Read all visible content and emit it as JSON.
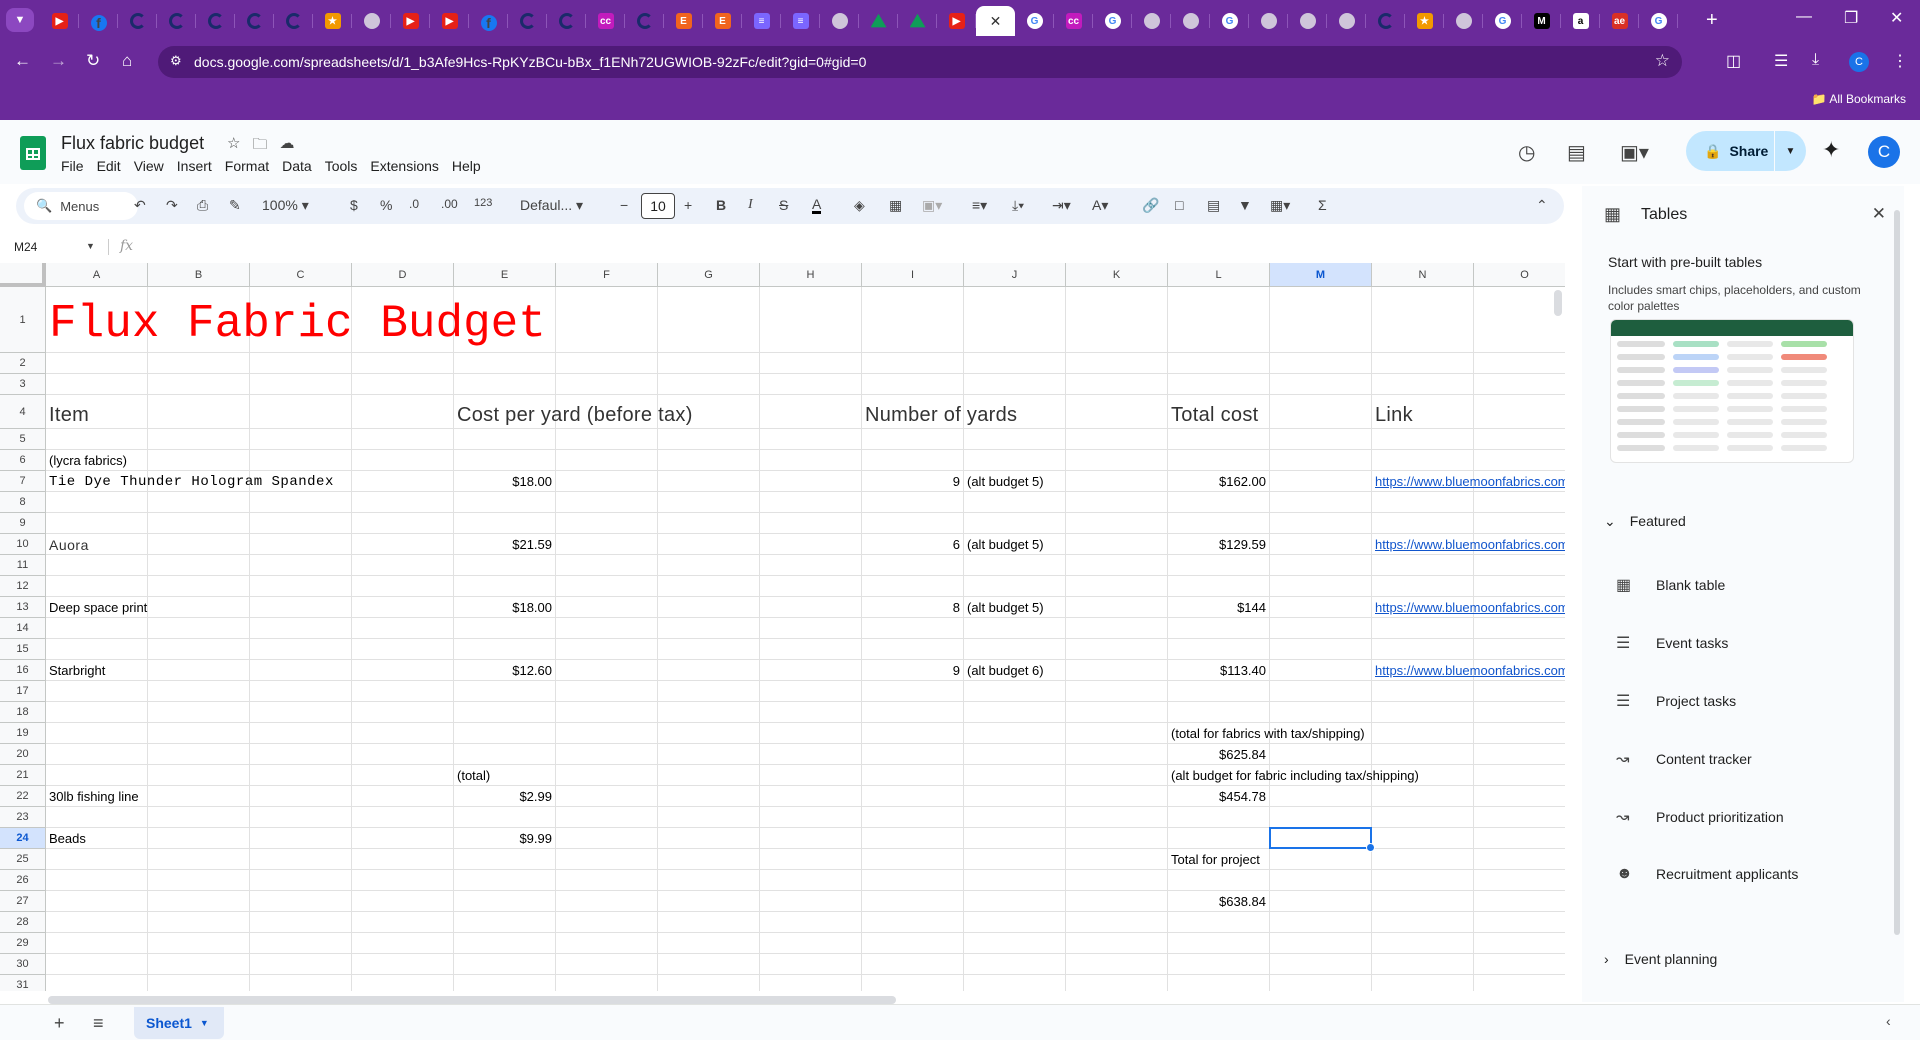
{
  "browser": {
    "url": "docs.google.com/spreadsheets/d/1_b3Afe9Hcs-RpKYzBCu-bBx_f1ENh72UGWIOB-92zFc/edit?gid=0#gid=0",
    "all_bookmarks": "All Bookmarks",
    "tab_favicons": [
      "y",
      "fb",
      "c",
      "c",
      "c",
      "c",
      "c",
      "or",
      "gr",
      "y",
      "y",
      "fb",
      "c",
      "c",
      "cc",
      "c",
      "e",
      "e",
      "gl",
      "gl",
      "gr",
      "dr",
      "dr",
      "y",
      "active",
      "g",
      "cc",
      "g",
      "gr",
      "gr",
      "g",
      "gr",
      "gr",
      "gr",
      "c",
      "or",
      "gr",
      "g",
      "blk",
      "am",
      "red2",
      "g"
    ],
    "profile_initial": "C"
  },
  "doc": {
    "title": "Flux fabric budget",
    "menus": [
      "File",
      "Edit",
      "View",
      "Insert",
      "Format",
      "Data",
      "Tools",
      "Extensions",
      "Help"
    ],
    "share_label": "Share",
    "avatar_initial": "C"
  },
  "toolbar": {
    "menus_label": "Menus",
    "zoom": "100%",
    "currency": "$",
    "percent": "%",
    "dec_decrease": ".0",
    "dec_increase": ".00",
    "number_format": "123",
    "font": "Defaul...",
    "font_size": "10"
  },
  "formula": {
    "name_box": "M24",
    "fx": "fx"
  },
  "grid": {
    "columns": [
      "A",
      "B",
      "C",
      "D",
      "E",
      "F",
      "G",
      "H",
      "I",
      "J",
      "K",
      "L",
      "M",
      "N",
      "O"
    ],
    "rows": [
      "1",
      "2",
      "3",
      "4",
      "5",
      "6",
      "7",
      "8",
      "9",
      "10",
      "11",
      "12",
      "13",
      "14",
      "15",
      "16",
      "17",
      "18",
      "19",
      "20",
      "21",
      "22",
      "23",
      "24",
      "25",
      "26",
      "27",
      "28",
      "29",
      "30",
      "31"
    ],
    "selected_column": "M",
    "selected_row": "24"
  },
  "cells": {
    "A1": "Flux Fabric Budget",
    "A4": "Item",
    "E4": "Cost per yard (before tax)",
    "I4": "Number of yards",
    "L4": "Total cost",
    "N4": "Link",
    "A6": "(lycra fabrics)",
    "A7": "Tie Dye Thunder Hologram Spandex",
    "E7": "$18.00",
    "I7": "9",
    "J7": "(alt budget 5)",
    "L7": "$162.00",
    "N7": "https://www.bluemoonfabrics.com",
    "A10": "Auora",
    "E10": "$21.59",
    "I10": "6",
    "J10": "(alt budget 5)",
    "L10": "$129.59",
    "N10": "https://www.bluemoonfabrics.com",
    "A13": "Deep space print",
    "E13": "$18.00",
    "I13": "8",
    "J13": "(alt budget 5)",
    "L13": "$144",
    "N13": "https://www.bluemoonfabrics.com",
    "A16": "Starbright",
    "E16": "$12.60",
    "I16": "9",
    "J16": "(alt budget 6)",
    "L16": "$113.40",
    "N16": "https://www.bluemoonfabrics.com",
    "L19": "(total for fabrics with tax/shipping)",
    "L20": "$625.84",
    "E21": "(total)",
    "L21": "(alt budget for fabric including tax/shipping)",
    "A22": "30lb fishing line",
    "E22": "$2.99",
    "L22": "$454.78",
    "A24": "Beads",
    "E24": "$9.99",
    "L25": "Total for project",
    "L27": "$638.84"
  },
  "sheet_tabs": [
    "Sheet1"
  ],
  "panel": {
    "title": "Tables",
    "prebuilt_heading": "Start with pre-built tables",
    "prebuilt_sub": "Includes smart chips, placeholders, and custom color palettes",
    "featured_label": "Featured",
    "templates": [
      {
        "label": "Blank table",
        "icon": "table-icon"
      },
      {
        "label": "Event tasks",
        "icon": "checklist-icon"
      },
      {
        "label": "Project tasks",
        "icon": "checklist-icon"
      },
      {
        "label": "Content tracker",
        "icon": "trend-icon"
      },
      {
        "label": "Product prioritization",
        "icon": "trend-icon"
      },
      {
        "label": "Recruitment applicants",
        "icon": "person-icon"
      }
    ],
    "event_planning_label": "Event planning"
  },
  "colors": {
    "chrome": "#6a2a9a",
    "title_red": "#ff0000",
    "link": "#1155cc",
    "selection": "#1a73e8"
  }
}
